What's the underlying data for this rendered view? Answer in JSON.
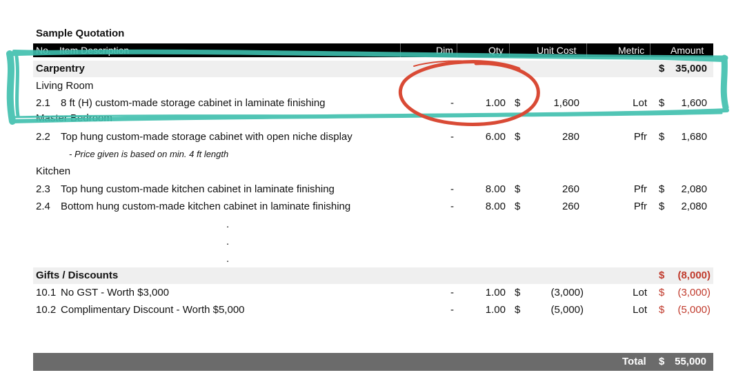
{
  "document": {
    "title": "Sample Quotation",
    "columns": {
      "no": "No.",
      "description": "Item Description",
      "dim": "Dim",
      "qty": "Qty",
      "unit_cost": "Unit Cost",
      "metric": "Metric",
      "amount": "Amount"
    },
    "carpentry": {
      "label": "Carpentry",
      "currency": "$",
      "amount": "35,000"
    },
    "living_room": "Living Room",
    "master_bedroom": "Master Bedroom",
    "kitchen": "Kitchen",
    "items": [
      {
        "no": "2.1",
        "desc": "8 ft (H) custom-made storage cabinet in laminate finishing",
        "dim": "-",
        "qty": "1.00",
        "cur": "$",
        "unit": "1,600",
        "metric": "Lot",
        "cur2": "$",
        "amount": "1,600"
      },
      {
        "no": "2.2",
        "desc": "Top hung custom-made storage cabinet with open niche display",
        "dim": "-",
        "qty": "6.00",
        "cur": "$",
        "unit": "280",
        "metric": "Pfr",
        "cur2": "$",
        "amount": "1,680"
      },
      {
        "no": "2.3",
        "desc": "Top hung custom-made kitchen cabinet in laminate finishing",
        "dim": "-",
        "qty": "8.00",
        "cur": "$",
        "unit": "260",
        "metric": "Pfr",
        "cur2": "$",
        "amount": "2,080"
      },
      {
        "no": "2.4",
        "desc": "Bottom hung custom-made kitchen cabinet in laminate finishing",
        "dim": "-",
        "qty": "8.00",
        "cur": "$",
        "unit": "260",
        "metric": "Pfr",
        "cur2": "$",
        "amount": "2,080"
      }
    ],
    "note_2_2": "- Price given is based on min. 4 ft length",
    "ellipsis": ".",
    "gifts": {
      "label": "Gifts / Discounts",
      "currency": "$",
      "amount": "(8,000)"
    },
    "discounts": [
      {
        "no": "10.1",
        "desc": "No GST - Worth $3,000",
        "dim": "-",
        "qty": "1.00",
        "cur": "$",
        "unit": "(3,000)",
        "metric": "Lot",
        "cur2": "$",
        "amount": "(3,000)"
      },
      {
        "no": "10.2",
        "desc": "Complimentary Discount - Worth $5,000",
        "dim": "-",
        "qty": "1.00",
        "cur": "$",
        "unit": "(5,000)",
        "metric": "Lot",
        "cur2": "$",
        "amount": "(5,000)"
      }
    ],
    "total": {
      "label": "Total",
      "currency": "$",
      "amount": "55,000"
    }
  },
  "colors": {
    "highlight_teal": "#3fbfae",
    "circle_red": "#d94a35",
    "discount_red": "#c0392b"
  }
}
